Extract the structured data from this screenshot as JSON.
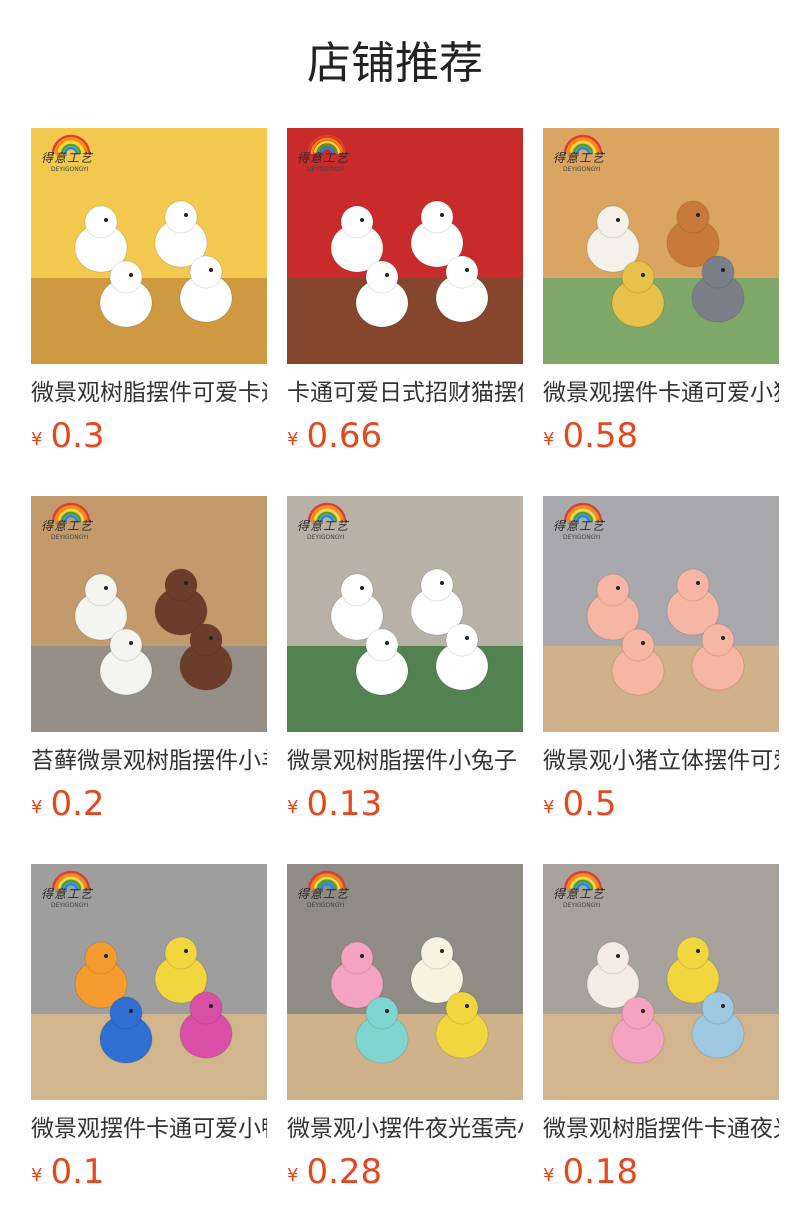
{
  "title": "店铺推荐",
  "products": [
    {
      "name": "微景观树脂摆件可爱卡通小鸡",
      "price": "0.3",
      "currency": "¥",
      "logo": "得意工艺",
      "logo_sub": "DEYIGONGYI",
      "bg": "#f2c84f",
      "accent": "#c9903f",
      "thumb_icon": "chicken-figurines"
    },
    {
      "name": "卡通可爱日式招财猫摆件",
      "price": "0.66",
      "currency": "¥",
      "logo": "得意工艺",
      "logo_sub": "DEYIGONGYI",
      "bg": "#c92b2b",
      "accent": "#7a4a2e",
      "thumb_icon": "lucky-cat-figurines"
    },
    {
      "name": "微景观摆件卡通可爱小狗",
      "price": "0.58",
      "currency": "¥",
      "logo": "得意工艺",
      "logo_sub": "DEYIGONGYI",
      "bg": "#d9a560",
      "accent": "#6fa86a",
      "thumb_icon": "puppy-figurines"
    },
    {
      "name": "苔藓微景观树脂摆件小羊",
      "price": "0.2",
      "currency": "¥",
      "logo": "得意工艺",
      "logo_sub": "DEYIGONGYI",
      "bg": "#c39a6b",
      "accent": "#8d8d8d",
      "thumb_icon": "sheep-figurines"
    },
    {
      "name": "微景观树脂摆件小兔子",
      "price": "0.13",
      "currency": "¥",
      "logo": "得意工艺",
      "logo_sub": "DEYIGONGYI",
      "bg": "#b7b1a6",
      "accent": "#3f7a3f",
      "thumb_icon": "rabbit-figurines"
    },
    {
      "name": "微景观小猪立体摆件可爱",
      "price": "0.5",
      "currency": "¥",
      "logo": "得意工艺",
      "logo_sub": "DEYIGONGYI",
      "bg": "#a9a9ad",
      "accent": "#d7b384",
      "thumb_icon": "piglet-figurines"
    },
    {
      "name": "微景观摆件卡通可爱小鸭子",
      "price": "0.1",
      "currency": "¥",
      "logo": "得意工艺",
      "logo_sub": "DEYIGONGYI",
      "bg": "#9e9e9e",
      "accent": "#d9b98a",
      "thumb_icon": "duck-figurines"
    },
    {
      "name": "微景观小摆件夜光蛋壳小鸡",
      "price": "0.28",
      "currency": "¥",
      "logo": "得意工艺",
      "logo_sub": "DEYIGONGYI",
      "bg": "#8f8c86",
      "accent": "#d9b98a",
      "thumb_icon": "eggshell-chick-figurines"
    },
    {
      "name": "微景观树脂摆件卡通夜光兔",
      "price": "0.18",
      "currency": "¥",
      "logo": "得意工艺",
      "logo_sub": "DEYIGONGYI",
      "bg": "#a7a39c",
      "accent": "#d9b98a",
      "thumb_icon": "glow-rabbit-figurines"
    }
  ]
}
